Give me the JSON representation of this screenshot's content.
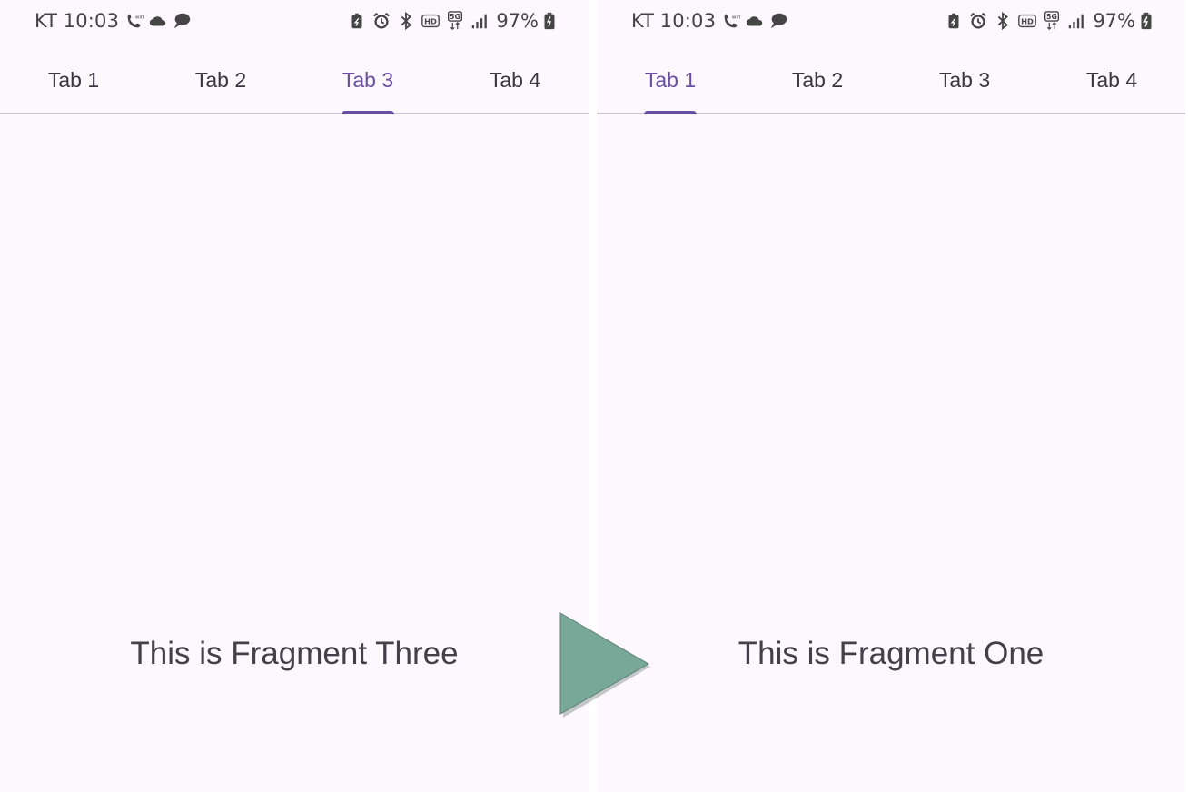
{
  "screens": [
    {
      "status_bar": {
        "carrier": "KT",
        "time": "10:03",
        "battery_percent": "97%",
        "left_icons": [
          "wifi-calling-icon",
          "cloud-icon",
          "chat-bubble-icon"
        ],
        "right_icons": [
          "battery-saver-icon",
          "alarm-icon",
          "bluetooth-icon",
          "hd-voice-icon",
          "5g-icon",
          "signal-icon",
          "battery-charging-icon"
        ]
      },
      "tabs": [
        {
          "label": "Tab 1",
          "active": false
        },
        {
          "label": "Tab 2",
          "active": false
        },
        {
          "label": "Tab 3",
          "active": true
        },
        {
          "label": "Tab 4",
          "active": false
        }
      ],
      "content_text": "This is Fragment Three"
    },
    {
      "status_bar": {
        "carrier": "KT",
        "time": "10:03",
        "battery_percent": "97%",
        "left_icons": [
          "wifi-calling-icon",
          "cloud-icon",
          "chat-bubble-icon"
        ],
        "right_icons": [
          "battery-saver-icon",
          "alarm-icon",
          "bluetooth-icon",
          "hd-voice-icon",
          "5g-icon",
          "signal-icon",
          "battery-charging-icon"
        ]
      },
      "tabs": [
        {
          "label": "Tab 1",
          "active": true
        },
        {
          "label": "Tab 2",
          "active": false
        },
        {
          "label": "Tab 3",
          "active": false
        },
        {
          "label": "Tab 4",
          "active": false
        }
      ],
      "content_text": "This is Fragment One"
    }
  ],
  "colors": {
    "background": "#fdf7fe",
    "accent": "#6750a4",
    "arrow": "#78a898"
  }
}
